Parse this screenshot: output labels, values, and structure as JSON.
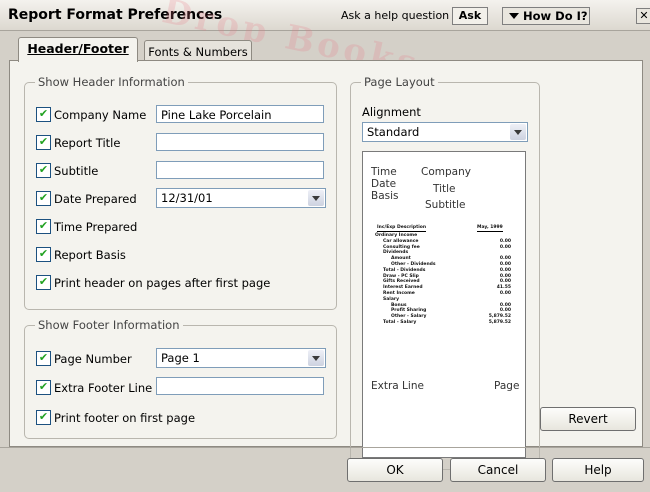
{
  "window": {
    "title": "Report Format Preferences",
    "help_question": "Ask a help question",
    "ask_label": "Ask",
    "how_do_label": "How Do I?",
    "close_glyph": "✕"
  },
  "watermark": "Drop Books",
  "tabs": [
    {
      "label": "Header/Footer",
      "active": true
    },
    {
      "label": "Fonts & Numbers",
      "active": false
    }
  ],
  "header_group": {
    "title": "Show Header Information",
    "rows": [
      {
        "label": "Company Name",
        "checked": true,
        "value": "Pine Lake Porcelain"
      },
      {
        "label": "Report Title",
        "checked": true,
        "value": ""
      },
      {
        "label": "Subtitle",
        "checked": true,
        "value": ""
      },
      {
        "label": "Date Prepared",
        "checked": true,
        "value": "12/31/01"
      },
      {
        "label": "Time Prepared",
        "checked": true
      },
      {
        "label": "Report Basis",
        "checked": true
      },
      {
        "label": "Print header on pages after first page",
        "checked": true
      }
    ]
  },
  "footer_group": {
    "title": "Show Footer Information",
    "rows": [
      {
        "label": "Page Number",
        "checked": true,
        "value": "Page 1"
      },
      {
        "label": "Extra Footer Line",
        "checked": true,
        "value": ""
      },
      {
        "label": "Print footer on first page",
        "checked": true
      }
    ]
  },
  "page_layout": {
    "title": "Page Layout",
    "alignment_label": "Alignment",
    "alignment_value": "Standard",
    "preview": {
      "time": "Time",
      "date": "Date",
      "basis": "Basis",
      "company": "Company",
      "title": "Title",
      "subtitle": "Subtitle",
      "col_desc": "Inc/Exp Description",
      "col_date": "May, 1999",
      "lines": [
        {
          "text": "Ordinary Income",
          "value": ""
        },
        {
          "text": "Car allowance",
          "value": "0.00"
        },
        {
          "text": "Consulting fee",
          "value": "0.00"
        },
        {
          "text": "Dividends",
          "value": ""
        },
        {
          "text": "Amount",
          "value": "0.00"
        },
        {
          "text": "Other - Dividends",
          "value": "0.00"
        },
        {
          "text": "Total - Dividends",
          "value": "0.00"
        },
        {
          "text": "Draw - PC Slip",
          "value": "0.00"
        },
        {
          "text": "Gifts Received",
          "value": "0.00"
        },
        {
          "text": "Interest Earned",
          "value": "41.55"
        },
        {
          "text": "Rent Income",
          "value": "0.00"
        },
        {
          "text": "Salary",
          "value": ""
        },
        {
          "text": "Bonus",
          "value": "0.00"
        },
        {
          "text": "Profit Sharing",
          "value": "0.00"
        },
        {
          "text": "Other - Salary",
          "value": "5,879.52"
        },
        {
          "text": "Total - Salary",
          "value": "5,879.52"
        }
      ],
      "extra_line": "Extra Line",
      "page": "Page"
    }
  },
  "buttons": {
    "revert": "Revert",
    "ok": "OK",
    "cancel": "Cancel",
    "help": "Help"
  }
}
